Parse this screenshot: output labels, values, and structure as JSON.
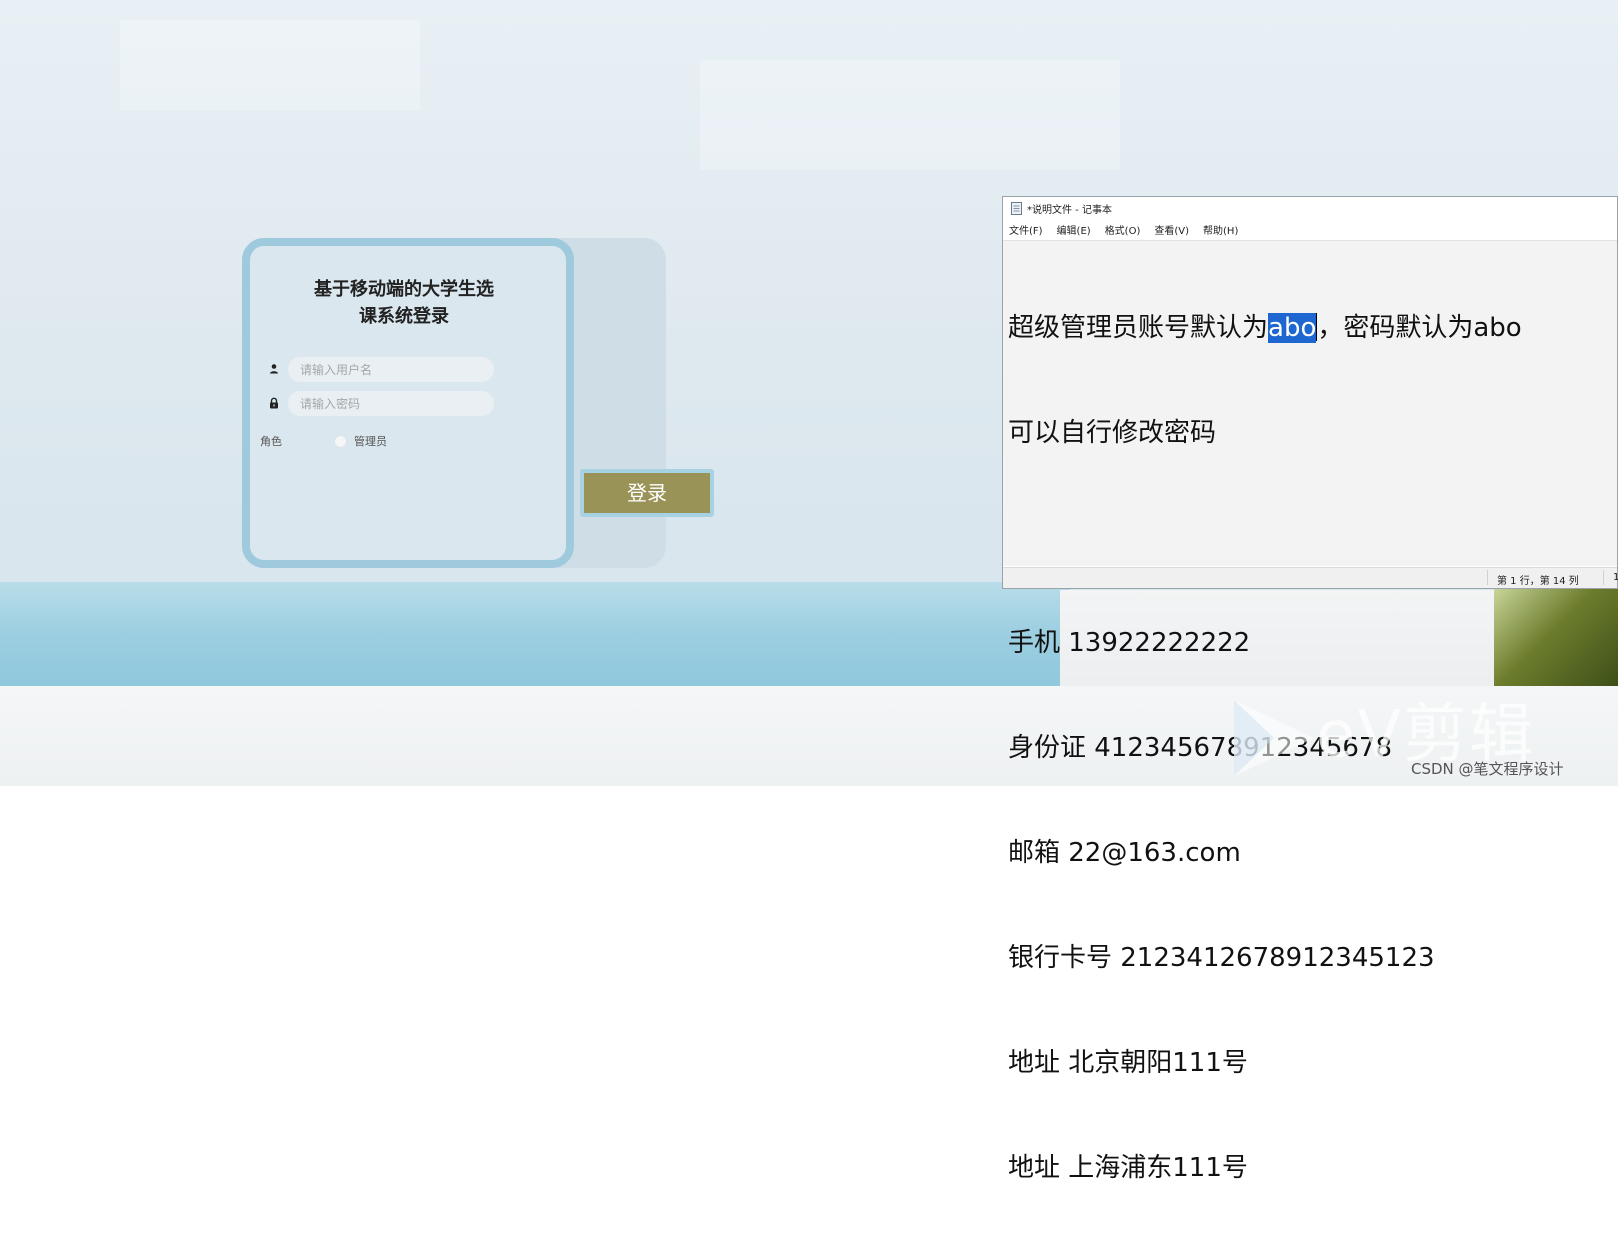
{
  "login": {
    "title_line1": "基于移动端的大学生选",
    "title_line2": "课系统登录",
    "username_placeholder": "请输入用户名",
    "password_placeholder": "请输入密码",
    "role_label": "角色",
    "role_option": "管理员",
    "submit_label": "登录"
  },
  "notepad": {
    "title": "*说明文件 - 记事本",
    "menu": [
      "文件(F)",
      "编辑(E)",
      "格式(O)",
      "查看(V)",
      "帮助(H)"
    ],
    "line1_before": "超级管理员账号默认为",
    "line1_selected": "abo",
    "line1_after": "，密码默认为abo",
    "lines": [
      "可以自行修改密码",
      "",
      "手机 13922222222",
      "身份证 412345678912345678",
      "邮箱 22@163.com",
      "银行卡号 212341267891234512­3",
      "地址 北京朝阳111号",
      "地址 上海浦东111号"
    ],
    "status_position": "第 1 行，第 14 列",
    "status_zoom": "1"
  },
  "watermark": {
    "ev_text": "eV剪辑",
    "csdn": "CSDN @笔文程序设计"
  },
  "colors": {
    "login_button": "#9a9358",
    "card_border": "#9fc9dc",
    "selection": "#1e66d0"
  },
  "icons": [
    "user-icon",
    "lock-icon",
    "notepad-file-icon",
    "ev-play-logo-icon"
  ]
}
